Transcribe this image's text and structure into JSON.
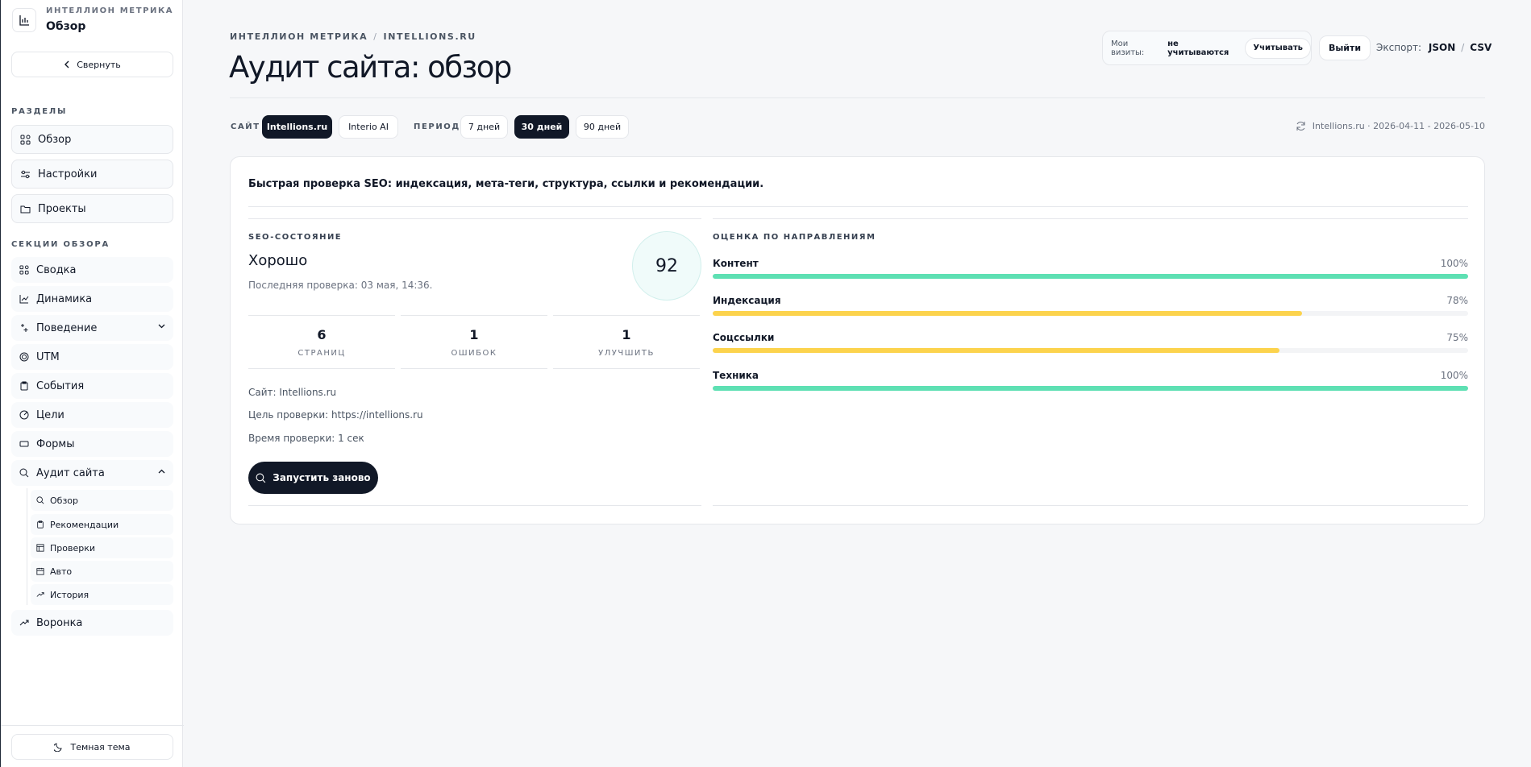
{
  "brand": {
    "name": "ИНТЕЛЛИОН МЕТРИКА",
    "current_page": "Обзор"
  },
  "sidebar": {
    "collapse_label": "Свернуть",
    "sections_title": "РАЗДЕЛЫ",
    "main_items": [
      {
        "label": "Обзор",
        "icon": "grid-icon"
      },
      {
        "label": "Настройки",
        "icon": "sliders-icon"
      },
      {
        "label": "Проекты",
        "icon": "folder-icon"
      }
    ],
    "overview_title": "СЕКЦИИ ОБЗОРА",
    "overview_items": [
      {
        "label": "Сводка",
        "icon": "grid-icon"
      },
      {
        "label": "Динамика",
        "icon": "line-chart-icon"
      },
      {
        "label": "Поведение",
        "icon": "sparkle-icon"
      },
      {
        "label": "UTM",
        "icon": "target-icon"
      },
      {
        "label": "События",
        "icon": "clipboard-icon"
      },
      {
        "label": "Цели",
        "icon": "goal-icon"
      },
      {
        "label": "Формы",
        "icon": "form-icon"
      },
      {
        "label": "Аудит сайта",
        "icon": "search-icon"
      }
    ],
    "audit_sub_items": [
      {
        "label": "Обзор",
        "icon": "search-icon"
      },
      {
        "label": "Рекомендации",
        "icon": "clipboard-icon"
      },
      {
        "label": "Проверки",
        "icon": "table-icon"
      },
      {
        "label": "Авто",
        "icon": "calendar-icon"
      },
      {
        "label": "История",
        "icon": "trend-icon"
      }
    ],
    "funnel_label": "Воронка",
    "theme_label": "Темная тема"
  },
  "header": {
    "breadcrumb": [
      "ИНТЕЛЛИОН МЕТРИКА",
      "INTELLIONS.RU"
    ],
    "title": "Аудит сайта: обзор",
    "visits_label": "Мои визиты:",
    "visits_value": "не учитываются",
    "count_button": "Учитывать",
    "logout_button": "Выйти",
    "export_label": "Экспорт:",
    "export_json": "JSON",
    "export_csv": "CSV"
  },
  "filters": {
    "site_label": "САЙТ",
    "sites": [
      "Intellions.ru",
      "Interio AI"
    ],
    "active_site": "Intellions.ru",
    "period_label": "ПЕРИОД",
    "periods": [
      "7 дней",
      "30 дней",
      "90 дней"
    ],
    "active_period": "30 дней",
    "range_text": "Intellions.ru · 2026-04-11 - 2026-05-10"
  },
  "card": {
    "description": "Быстрая проверка SEO: индексация, мета-теги, структура, ссылки и рекомендации.",
    "seo_label": "SEO-СОСТОЯНИЕ",
    "status": "Хорошо",
    "last_check": "Последняя проверка: 03 мая, 14:36.",
    "score": "92",
    "stats": [
      {
        "num": "6",
        "caption": "СТРАНИЦ"
      },
      {
        "num": "1",
        "caption": "ОШИБОК"
      },
      {
        "num": "1",
        "caption": "УЛУЧШИТЬ"
      }
    ],
    "info_site": "Сайт: Intellions.ru",
    "info_target": "Цель проверки: https://intellions.ru",
    "info_time": "Время проверки: 1 сек",
    "rerun_button": "Запустить заново",
    "directions_label": "ОЦЕНКА ПО НАПРАВЛЕНИЯМ",
    "directions": [
      {
        "name": "Контент",
        "value": "100%",
        "fraction": 1.0,
        "color": "#5ee0b3"
      },
      {
        "name": "Индексация",
        "value": "78%",
        "fraction": 0.78,
        "color": "#fcd34d"
      },
      {
        "name": "Соцссылки",
        "value": "75%",
        "fraction": 0.75,
        "color": "#fcd34d"
      },
      {
        "name": "Техника",
        "value": "100%",
        "fraction": 1.0,
        "color": "#5ee0b3"
      }
    ]
  },
  "colors": {
    "primary_dark": "#111827",
    "good": "#5ee0b3",
    "warn": "#fcd34d"
  }
}
